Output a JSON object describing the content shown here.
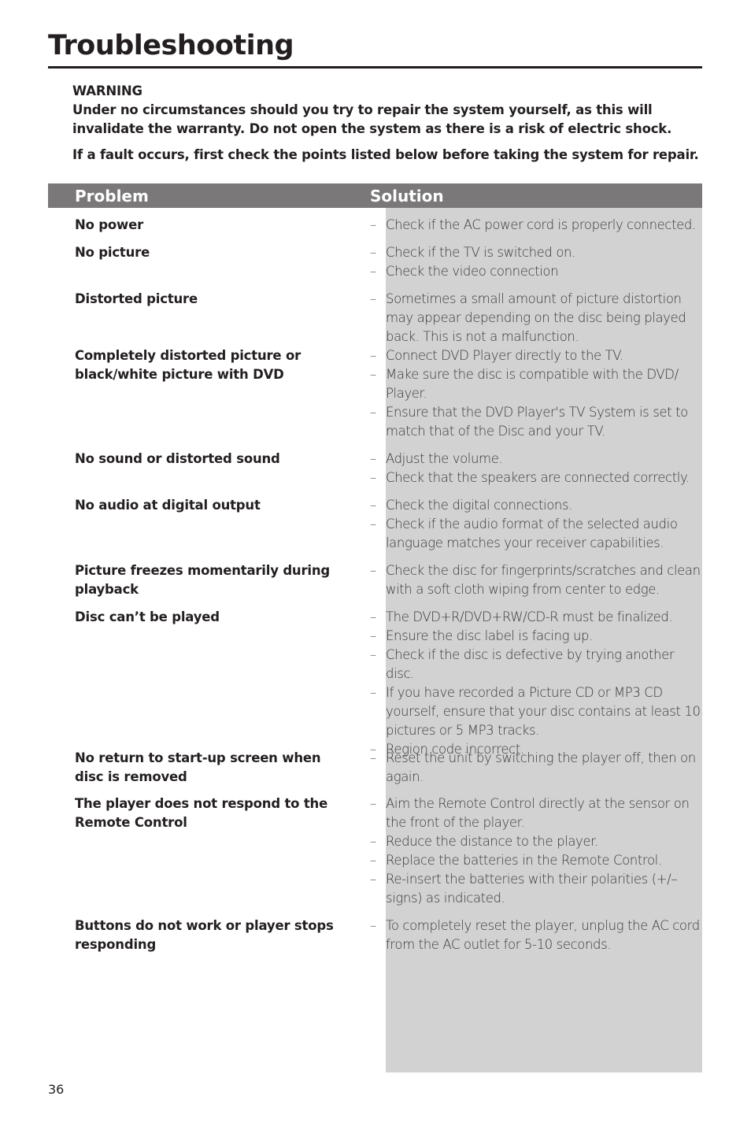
{
  "page": {
    "title": "Troubleshooting",
    "page_number": "36",
    "colors": {
      "header_bg": "#7a7879",
      "solution_bg": "#d2d2d2",
      "text": "#231f20"
    }
  },
  "warning": {
    "heading": "WARNING",
    "body": "Under no circumstances should you try to repair the system yourself, as this will invalidate the warranty.  Do not open the system as there is a risk of electric shock.",
    "note": "If a fault occurs, first check the points listed below before taking the system for repair."
  },
  "table": {
    "headers": {
      "problem": "Problem",
      "solution": "Solution"
    },
    "bullet_icon": "–",
    "rows": [
      {
        "problem": "No power",
        "solutions": [
          "Check if the AC power cord is properly connected."
        ]
      },
      {
        "problem": "No picture",
        "solutions": [
          "Check if the TV is switched on.",
          "Check the video connection"
        ]
      },
      {
        "problem": "Distorted picture",
        "solutions": [
          "Sometimes a small amount of picture distortion may appear depending on the disc being played back. This is not a malfunction."
        ]
      },
      {
        "problem": "Completely distorted picture or black/white picture with DVD",
        "solutions": [
          "Connect DVD Player directly to the TV.",
          "Make sure the disc is compatible with the DVD/ Player.",
          "Ensure that the DVD Player's TV System is set to match that of the Disc and your TV."
        ]
      },
      {
        "problem": "No sound or distorted sound",
        "solutions": [
          "Adjust the volume.",
          "Check that the speakers are connected correctly."
        ]
      },
      {
        "problem": "No audio at digital output",
        "solutions": [
          "Check the digital connections.",
          "Check if the audio format of the selected audio language matches your receiver capabilities."
        ]
      },
      {
        "problem": "Picture freezes momentarily during playback",
        "solutions": [
          "Check the disc for fingerprints/scratches and clean with a soft cloth wiping from center to edge."
        ]
      },
      {
        "problem": "Disc can’t be played",
        "solutions": [
          "The DVD+R/DVD+RW/CD-R must be finalized.",
          "Ensure the disc label is facing up.",
          "Check if the disc is defective by trying another disc.",
          "If you have recorded a Picture CD or MP3 CD yourself, ensure that your disc contains at least 10 pictures or 5 MP3 tracks.",
          "Region code incorrect."
        ]
      },
      {
        "problem": "No return to start-up screen when disc is removed",
        "solutions": [
          "Reset the unit by switching the player off, then on again."
        ]
      },
      {
        "problem": "The player does not respond to the Remote Control",
        "solutions": [
          "Aim the Remote Control directly at the sensor on the front of the player.",
          "Reduce the distance to the player.",
          "Replace the batteries in the Remote Control.",
          "Re-insert the batteries with their polarities (+/– signs) as indicated."
        ]
      },
      {
        "problem": "Buttons do not work or player stops responding",
        "solutions": [
          "To completely reset the player, unplug the AC cord from the AC outlet for 5-10 seconds."
        ]
      }
    ]
  }
}
